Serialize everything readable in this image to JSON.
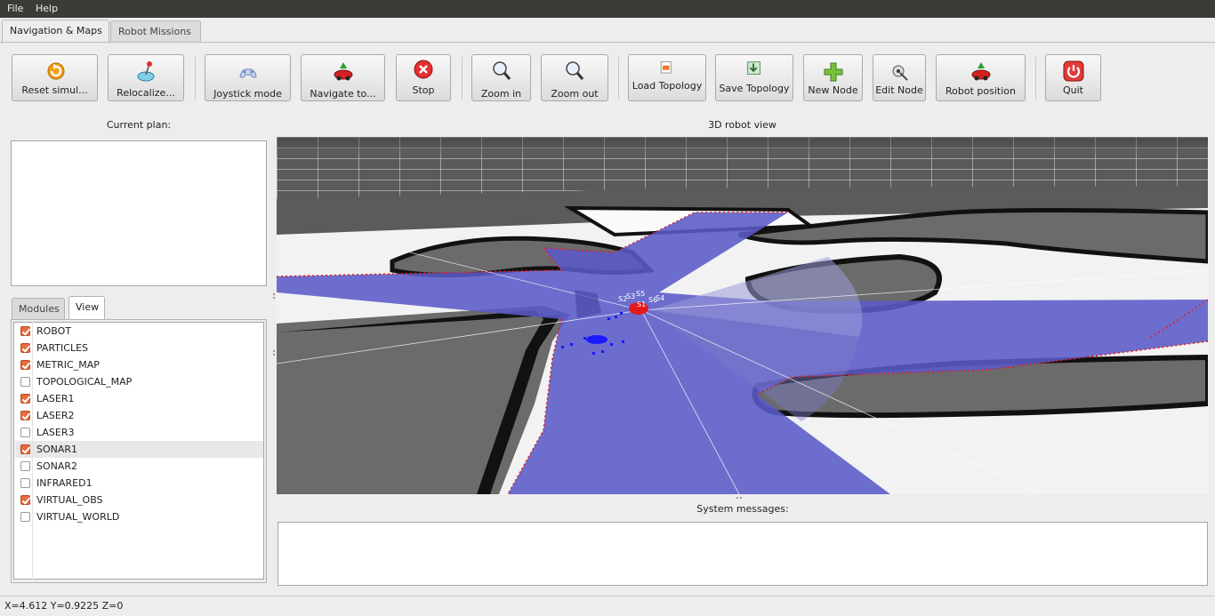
{
  "menubar": {
    "file": "File",
    "help": "Help"
  },
  "tabs": [
    {
      "label": "Navigation & Maps",
      "active": true
    },
    {
      "label": "Robot Missions",
      "active": false
    }
  ],
  "toolbar": {
    "reset": "Reset simul...",
    "relocalize": "Relocalize...",
    "joystick": "Joystick mode",
    "navigate": "Navigate to...",
    "stop": "Stop",
    "zoom_in": "Zoom in",
    "zoom_out": "Zoom out",
    "load_topology": "Load Topology",
    "save_topology": "Save Topology",
    "new_node": "New Node",
    "edit_node": "Edit Node",
    "robot_position": "Robot position",
    "quit": "Quit"
  },
  "left_panel": {
    "current_plan_label": "Current plan:",
    "subtabs": [
      "Modules",
      "View"
    ],
    "active_subtab": "View",
    "view_items": [
      {
        "name": "ROBOT",
        "checked": true
      },
      {
        "name": "PARTICLES",
        "checked": true
      },
      {
        "name": "METRIC_MAP",
        "checked": true
      },
      {
        "name": "TOPOLOGICAL_MAP",
        "checked": false
      },
      {
        "name": "LASER1",
        "checked": true
      },
      {
        "name": "LASER2",
        "checked": true
      },
      {
        "name": "LASER3",
        "checked": false
      },
      {
        "name": "SONAR1",
        "checked": true,
        "selected": true
      },
      {
        "name": "SONAR2",
        "checked": false
      },
      {
        "name": "INFRARED1",
        "checked": false
      },
      {
        "name": "VIRTUAL_OBS",
        "checked": true
      },
      {
        "name": "VIRTUAL_WORLD",
        "checked": false
      }
    ]
  },
  "view3d": {
    "label": "3D robot view",
    "sonar_labels": [
      "S2",
      "S3",
      "S5",
      "S6",
      "S4",
      "S1"
    ]
  },
  "messages": {
    "label": "System messages:"
  },
  "status": {
    "coords": "X=4.612 Y=0.9225 Z=0"
  },
  "colors": {
    "menubar": "#3c3b37",
    "accent_checkbox": "#e96a3a",
    "laser_scan": "#6a6acc",
    "obstacle_points": "#e02020",
    "particles": "#1a1aff"
  }
}
